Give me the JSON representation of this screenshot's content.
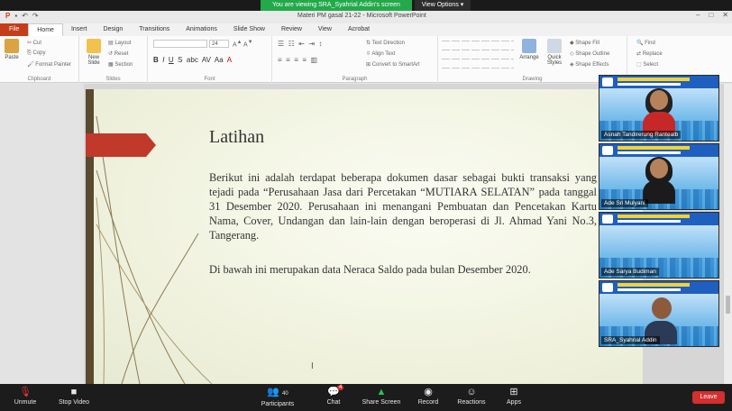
{
  "zoom": {
    "viewing_text": "You are viewing SRA_Syahrial Addin's screen",
    "view_options": "View Options ▾",
    "toolbar": {
      "unmute": "Unmute",
      "stop_video": "Stop Video",
      "participants": "Participants",
      "participants_count": "40",
      "chat": "Chat",
      "chat_badge": "4",
      "share_screen": "Share Screen",
      "record": "Record",
      "reactions": "Reactions",
      "apps": "Apps",
      "leave": "Leave"
    },
    "participants_tiles": [
      {
        "name": "Asnah Tandirerung Rantealb"
      },
      {
        "name": "Ade Sri Mulyani"
      },
      {
        "name": "Ade Sarya Budiman"
      },
      {
        "name": "SRA_Syahrial Addin"
      }
    ]
  },
  "ppt": {
    "window_title": "Materi PM gasal 21-22 - Microsoft PowerPoint",
    "tabs": [
      "File",
      "Home",
      "Insert",
      "Design",
      "Transitions",
      "Animations",
      "Slide Show",
      "Review",
      "View",
      "Acrobat"
    ],
    "ribbon": {
      "clipboard": {
        "label": "Clipboard",
        "paste": "Paste",
        "cut": "Cut",
        "copy": "Copy",
        "format_painter": "Format Painter"
      },
      "slides": {
        "label": "Slides",
        "new_slide": "New Slide",
        "layout": "Layout",
        "reset": "Reset",
        "section": "Section"
      },
      "font": {
        "label": "Font",
        "font_size": "24"
      },
      "paragraph": {
        "label": "Paragraph",
        "text_direction": "Text Direction",
        "align_text": "Align Text",
        "smartart": "Convert to SmartArt"
      },
      "drawing": {
        "label": "Drawing",
        "arrange": "Arrange",
        "quick_styles": "Quick Styles",
        "shape_fill": "Shape Fill",
        "shape_outline": "Shape Outline",
        "shape_effects": "Shape Effects"
      },
      "editing": {
        "find": "Find",
        "replace": "Replace",
        "select": "Select"
      }
    },
    "slide": {
      "title": "Latihan",
      "paragraph1": "Berikut ini adalah terdapat beberapa dokumen dasar sebagai bukti transaksi yang tejadi pada “Perusahaan Jasa dari Percetakan “MUTIARA SELATAN” pada tanggal 31 Desember 2020. Perusahaan ini menangani Pembuatan dan Pencetakan Kartu Nama, Cover, Undangan dan lain-lain dengan beroperasi di Jl. Ahmad Yani No.3, Tangerang.",
      "paragraph2": "Di bawah ini merupakan data Neraca Saldo pada bulan Desember 2020."
    }
  }
}
